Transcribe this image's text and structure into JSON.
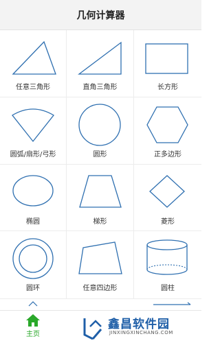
{
  "header": {
    "title": "几何计算器"
  },
  "shapes": [
    {
      "label": "任意三角形",
      "icon": "triangle-icon"
    },
    {
      "label": "直角三角形",
      "icon": "right-triangle-icon"
    },
    {
      "label": "长方形",
      "icon": "rectangle-icon"
    },
    {
      "label": "圆弧/扇形/弓形",
      "icon": "sector-icon"
    },
    {
      "label": "圆形",
      "icon": "circle-icon"
    },
    {
      "label": "正多边形",
      "icon": "hexagon-icon"
    },
    {
      "label": "椭圆",
      "icon": "ellipse-icon"
    },
    {
      "label": "梯形",
      "icon": "trapezoid-icon"
    },
    {
      "label": "菱形",
      "icon": "rhombus-icon"
    },
    {
      "label": "圆环",
      "icon": "ring-icon"
    },
    {
      "label": "任意四边形",
      "icon": "quadrilateral-icon"
    },
    {
      "label": "圆柱",
      "icon": "cylinder-icon"
    }
  ],
  "bottom_nav": {
    "home_label": "主页",
    "home_icon": "home-icon"
  },
  "watermark": {
    "text": "鑫昌软件园",
    "sub": "JINXINGXINCHANG.COM"
  },
  "colors": {
    "shape_stroke": "#2e6fb0",
    "home_green": "#2aa82a",
    "watermark_blue": "#1f5fa8"
  }
}
